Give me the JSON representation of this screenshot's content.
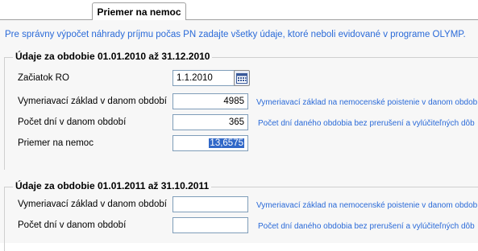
{
  "tabs": [
    {
      "label": "Priemer na nemoc"
    }
  ],
  "intro_text": "Pre správny výpočet náhrady príjmu počas PN zadajte všetky údaje, ktoré neboli evidované v programe OLYMP.",
  "period1": {
    "title": "Údaje za obdobie 01.01.2010 až 31.12.2010",
    "start_label": "Začiatok RO",
    "start_value": "1.1.2010",
    "base_label": "Vymeriavací základ v danom období",
    "base_value": "4985",
    "base_hint": "Vymeriavací základ na nemocenské poistenie v danom období",
    "days_label": "Počet dní v danom období",
    "days_value": "365",
    "days_hint": "Počet dní daného obdobia bez prerušení a vylúčiteľných dôb",
    "avg_label": "Priemer na nemoc",
    "avg_value": "13,6575"
  },
  "period2": {
    "title": "Údaje za obdobie 01.01.2011 až 31.10.2011",
    "base_label": "Vymeriavací základ v danom období",
    "base_value": "",
    "base_hint": "Vymeriavací základ na nemocenské poistenie v danom období",
    "days_label": "Počet dní v danom období",
    "days_value": "",
    "days_hint": "Počet dní daného obdobia bez prerušení a vylúčiteľných dôb"
  },
  "colors": {
    "link_blue": "#2a6ad8",
    "selection": "#3168c8",
    "field_border": "#7f9db9"
  },
  "icons": {
    "calendar": "calendar-icon"
  }
}
